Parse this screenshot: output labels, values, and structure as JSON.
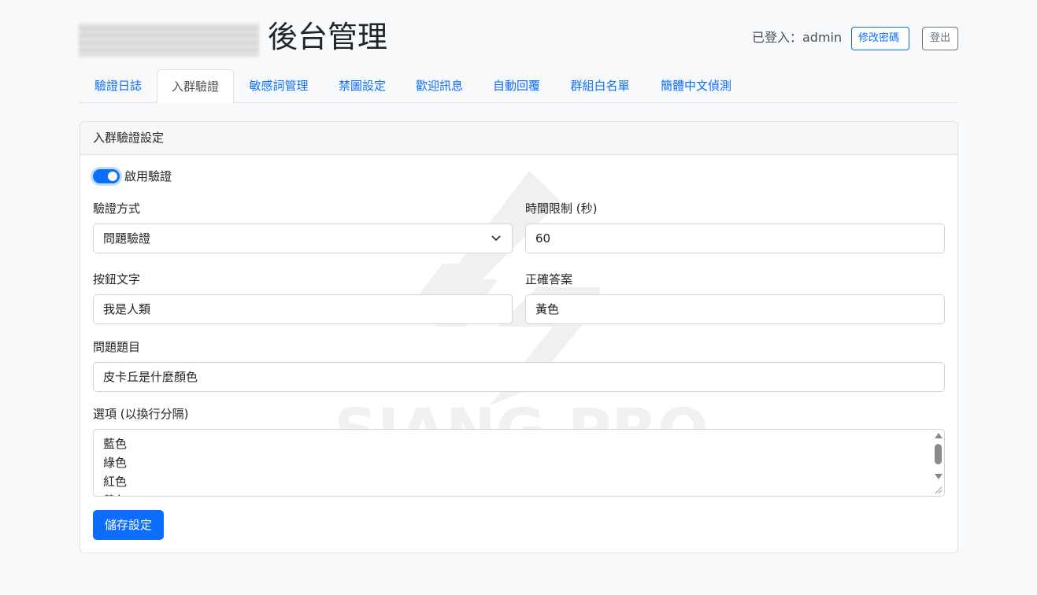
{
  "header": {
    "title": "後台管理",
    "logged_in_text": "已登入：admin",
    "change_password_label": "修改密碼",
    "logout_label": "登出"
  },
  "tabs": [
    {
      "label": "驗證日誌"
    },
    {
      "label": "入群驗證"
    },
    {
      "label": "敏感詞管理"
    },
    {
      "label": "禁圖設定"
    },
    {
      "label": "歡迎訊息"
    },
    {
      "label": "自動回覆"
    },
    {
      "label": "群組白名單"
    },
    {
      "label": "簡體中文偵測"
    }
  ],
  "active_tab": "入群驗證",
  "card": {
    "title": "入群驗證設定",
    "enable_label": "啟用驗證",
    "enabled": true,
    "method_label": "驗證方式",
    "method_value": "問題驗證",
    "time_limit_label": "時間限制 (秒)",
    "time_limit_value": "60",
    "button_text_label": "按鈕文字",
    "button_text_value": "我是人類",
    "answer_label": "正確答案",
    "answer_value": "黃色",
    "question_label": "問題題目",
    "question_value": "皮卡丘是什麼顏色",
    "options_label": "選項 (以換行分隔)",
    "options": [
      "藍色",
      "綠色",
      "紅色",
      "黃色"
    ],
    "save_label": "儲存設定"
  },
  "watermark": {
    "text": "SIANG.PRO"
  },
  "colors": {
    "primary": "#0d6efd",
    "border": "#dee2e6",
    "background": "#f8f9fa"
  }
}
